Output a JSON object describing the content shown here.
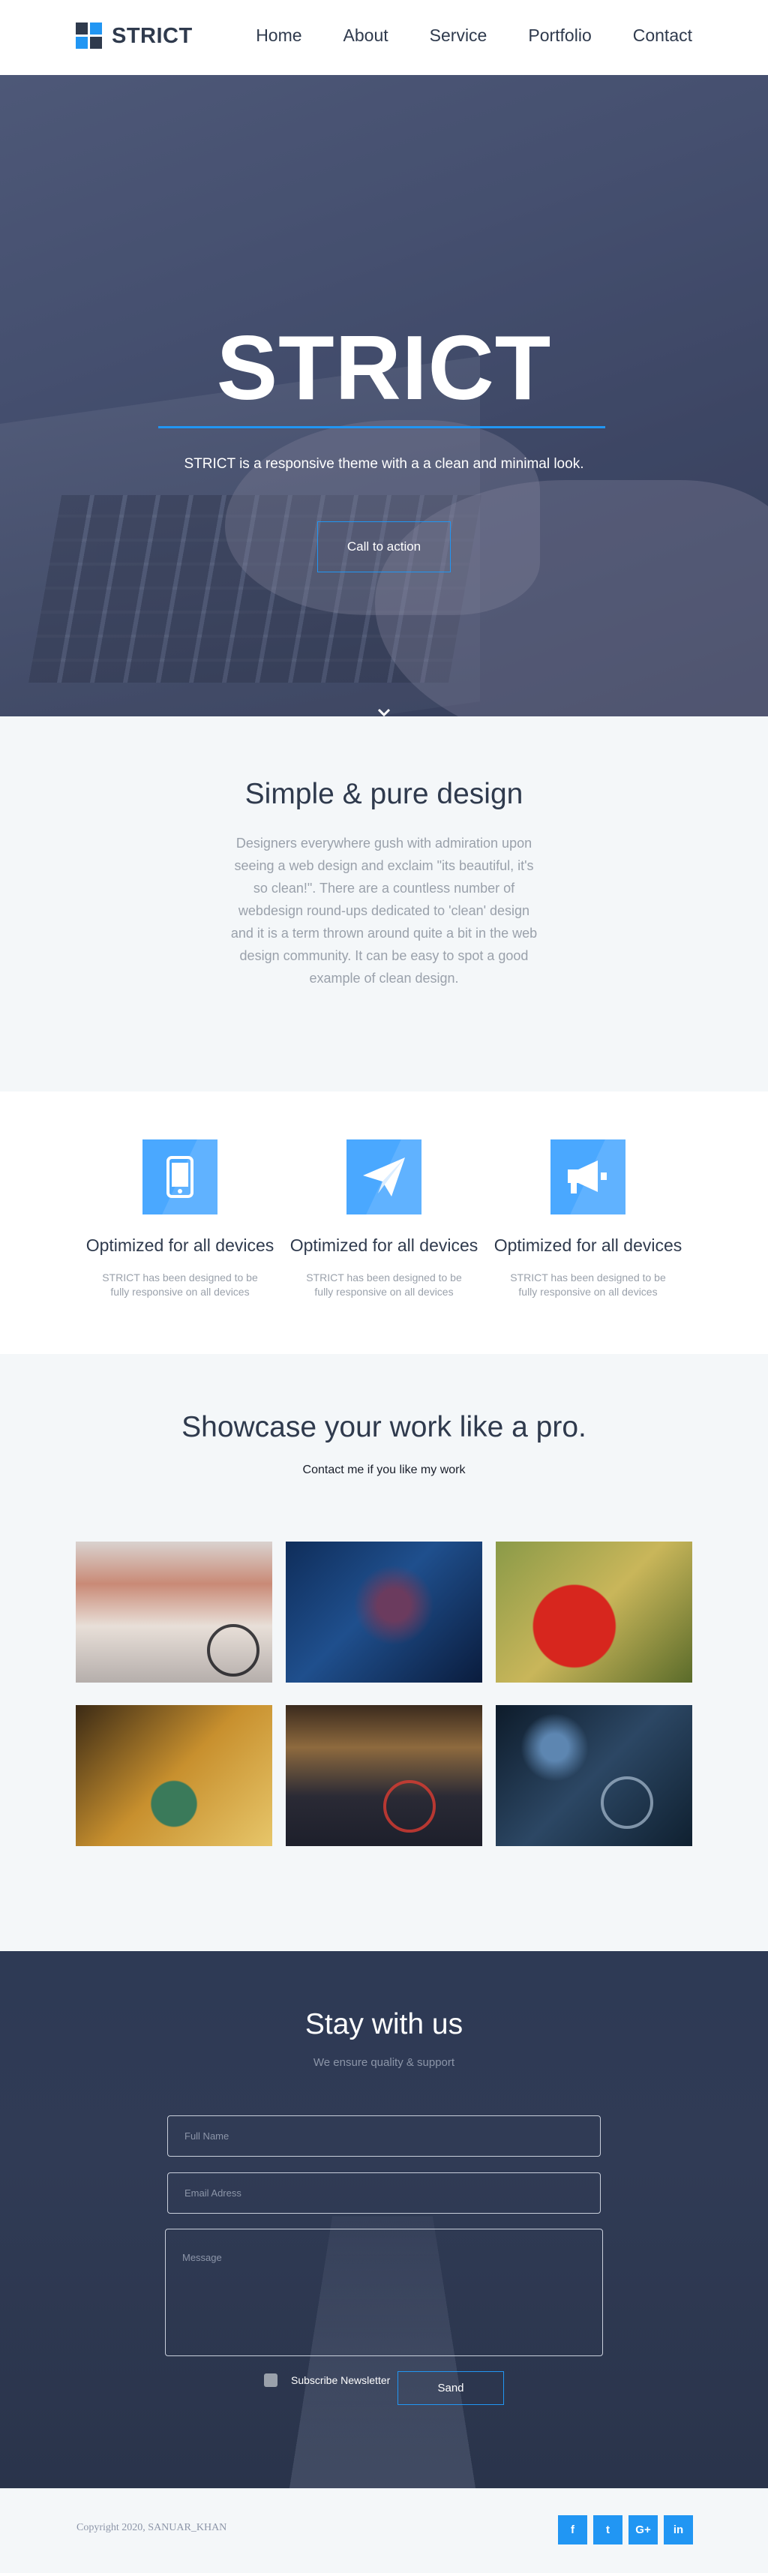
{
  "header": {
    "logo_text": "STRICT",
    "nav": [
      {
        "label": "Home"
      },
      {
        "label": "About"
      },
      {
        "label": "Service"
      },
      {
        "label": "Portfolio"
      },
      {
        "label": "Contact"
      }
    ]
  },
  "hero": {
    "title": "STRICT",
    "subtitle": "STRICT is a responsive theme with a a clean and minimal look.",
    "cta_label": "Call to action",
    "scroll_icon": "chevron-down-icon"
  },
  "intro": {
    "title": "Simple & pure design",
    "text": "Designers everywhere gush with admiration upon seeing a web design and exclaim \"its beautiful, it's so clean!\". There are a countless number of webdesign round-ups dedicated to 'clean' design and it is a term thrown around quite a bit in the web design community. It can be easy to spot a good example of clean design."
  },
  "features": [
    {
      "icon": "mobile-icon",
      "title": "Optimized for all devices",
      "text": "STRICT has been designed to be fully responsive on all devices"
    },
    {
      "icon": "paper-plane-icon",
      "title": "Optimized for all devices",
      "text": "STRICT has been designed to be fully responsive on all devices"
    },
    {
      "icon": "megaphone-icon",
      "title": "Optimized for all devices",
      "text": "STRICT has been designed to be fully responsive on all devices"
    }
  ],
  "showcase": {
    "title": "Showcase your work like a pro.",
    "subtitle": "Contact me if you like my work"
  },
  "contact": {
    "title": "Stay with us",
    "subtitle": "We ensure quality & support",
    "full_name_placeholder": "Full Name",
    "email_placeholder": "Email Adress",
    "message_placeholder": "Message",
    "subscribe_label": "Subscribe Newsletter",
    "send_label": "Sand"
  },
  "footer": {
    "copyright": "Copyright 2020, SANUAR_KHAN",
    "social": [
      {
        "icon": "facebook-icon",
        "glyph": "f"
      },
      {
        "icon": "twitter-icon",
        "glyph": "t"
      },
      {
        "icon": "google-plus-icon",
        "glyph": "G+"
      },
      {
        "icon": "linkedin-icon",
        "glyph": "in"
      }
    ]
  },
  "colors": {
    "accent": "#2196f3",
    "dark": "#2f3a4d",
    "light_bg": "#f4f7f9",
    "muted_text": "#9aa1ab"
  }
}
